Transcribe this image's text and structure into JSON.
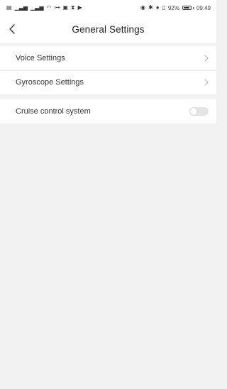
{
  "status_bar": {
    "left_text": "HD HD 4G 4G",
    "right_text": "92%",
    "time": "09:49",
    "battery_level": 0.92,
    "icons_left": [
      "hd-icon",
      "signal-icon",
      "signal-icon",
      "wifi-icon",
      "vpn-key-icon",
      "nfc-icon",
      "hourglass-icon",
      "media-icon"
    ],
    "icons_right": [
      "alarm-icon",
      "bluetooth-icon",
      "location-icon",
      "vibrate-icon"
    ]
  },
  "header": {
    "title": "General Settings"
  },
  "settings": {
    "voice_label": "Voice Settings",
    "gyroscope_label": "Gyroscope Settings",
    "cruise_label": "Cruise control system",
    "cruise_enabled": false
  }
}
